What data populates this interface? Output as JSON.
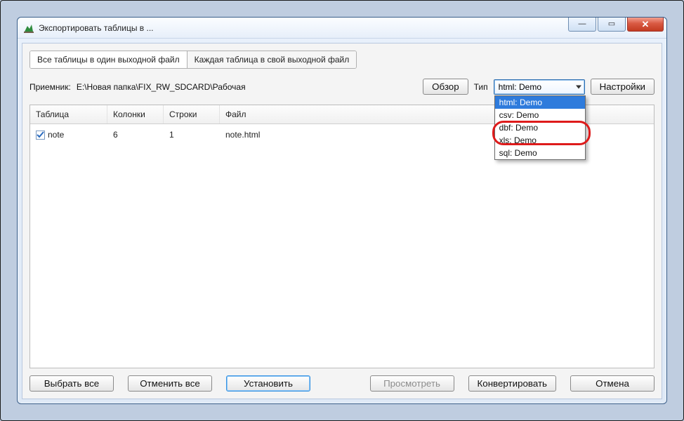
{
  "window": {
    "title": "Экспортировать таблицы в ..."
  },
  "tabs": {
    "all_one": "Все таблицы в один выходной файл",
    "each_own": "Каждая таблица в свой выходной файл"
  },
  "receiver": {
    "label": "Приемник:",
    "path": "E:\\Новая папка\\FIX_RW_SDCARD\\Рабочая",
    "browse": "Обзор",
    "type_label": "Тип",
    "settings": "Настройки"
  },
  "type_select": {
    "selected": "html: Demo",
    "options": [
      "html: Demo",
      "csv: Demo",
      "dbf: Demo",
      "xls: Demo",
      "sql: Demo"
    ]
  },
  "list": {
    "headers": {
      "table": "Таблица",
      "cols": "Колонки",
      "rows": "Строки",
      "file": "Файл"
    },
    "rows": [
      {
        "checked": true,
        "table": "note",
        "cols": "6",
        "rows": "1",
        "file": "note.html"
      }
    ]
  },
  "buttons": {
    "select_all": "Выбрать все",
    "deselect_all": "Отменить все",
    "apply": "Установить",
    "preview": "Просмотреть",
    "convert": "Конвертировать",
    "cancel": "Отмена"
  }
}
